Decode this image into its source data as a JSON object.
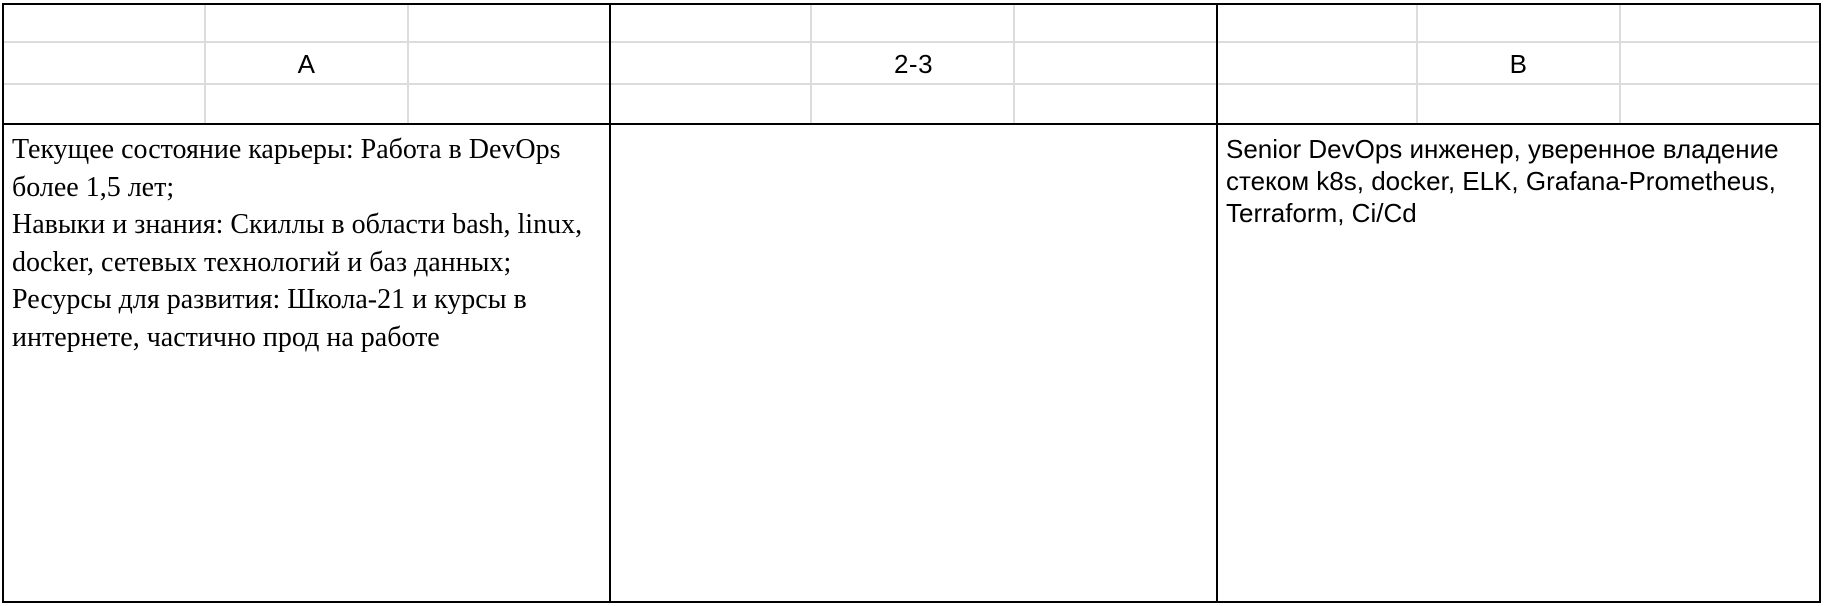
{
  "table": {
    "headers": [
      "A",
      "2-3",
      "B"
    ],
    "cells": [
      "Текущее состояние карьеры: Работа в DevOps более 1,5 лет;\nНавыки и знания: Скиллы в области bash, linux, docker, сетевых технологий и баз данных;\nРесурсы для развития: Школа-21 и курсы в интернете, частично прод на работе",
      "",
      "Senior DevOps инженер, уверенное владение стеком k8s, docker, ELK, Grafana-Prometheus, Terraform, Ci/Cd"
    ]
  }
}
